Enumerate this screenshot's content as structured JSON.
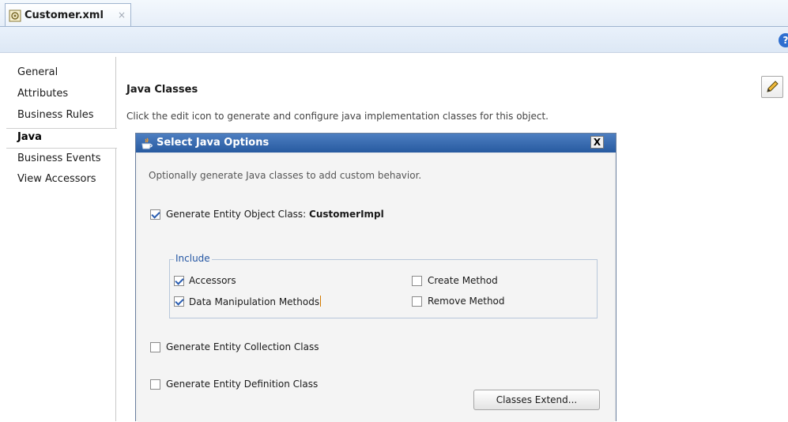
{
  "tab": {
    "title": "Customer.xml",
    "close": "×"
  },
  "help": {
    "glyph": "?"
  },
  "nav": {
    "items": [
      {
        "label": "General",
        "selected": false
      },
      {
        "label": "Attributes",
        "selected": false
      },
      {
        "label": "Business Rules",
        "selected": false
      },
      {
        "label": "Java",
        "selected": true
      },
      {
        "label": "Business Events",
        "selected": false
      },
      {
        "label": "View Accessors",
        "selected": false
      }
    ]
  },
  "content": {
    "title": "Java Classes",
    "description": "Click the edit icon to generate and configure java implementation classes for this object."
  },
  "dialog": {
    "title": "Select Java Options",
    "close": "X",
    "description": "Optionally generate Java classes to add custom behavior.",
    "entity_object": {
      "label": "Generate Entity Object Class: ",
      "class_name": "CustomerImpl",
      "checked": true
    },
    "include": {
      "legend": "Include",
      "accessors": {
        "label": "Accessors",
        "checked": true
      },
      "data_manipulation": {
        "label": "Data Manipulation Methods",
        "checked": true
      },
      "create_method": {
        "label": "Create Method",
        "checked": false
      },
      "remove_method": {
        "label": "Remove Method",
        "checked": false
      }
    },
    "collection_class": {
      "label": "Generate Entity Collection Class",
      "checked": false
    },
    "definition_class": {
      "label": "Generate Entity Definition Class",
      "checked": false
    },
    "extend_button": "Classes Extend..."
  },
  "colors": {
    "accent": "#275aa0",
    "titlebar": "#4e7fc1"
  },
  "icons": [
    "xml-file-icon",
    "help-icon",
    "edit-pencil-icon",
    "java-cup-icon",
    "close-icon"
  ]
}
